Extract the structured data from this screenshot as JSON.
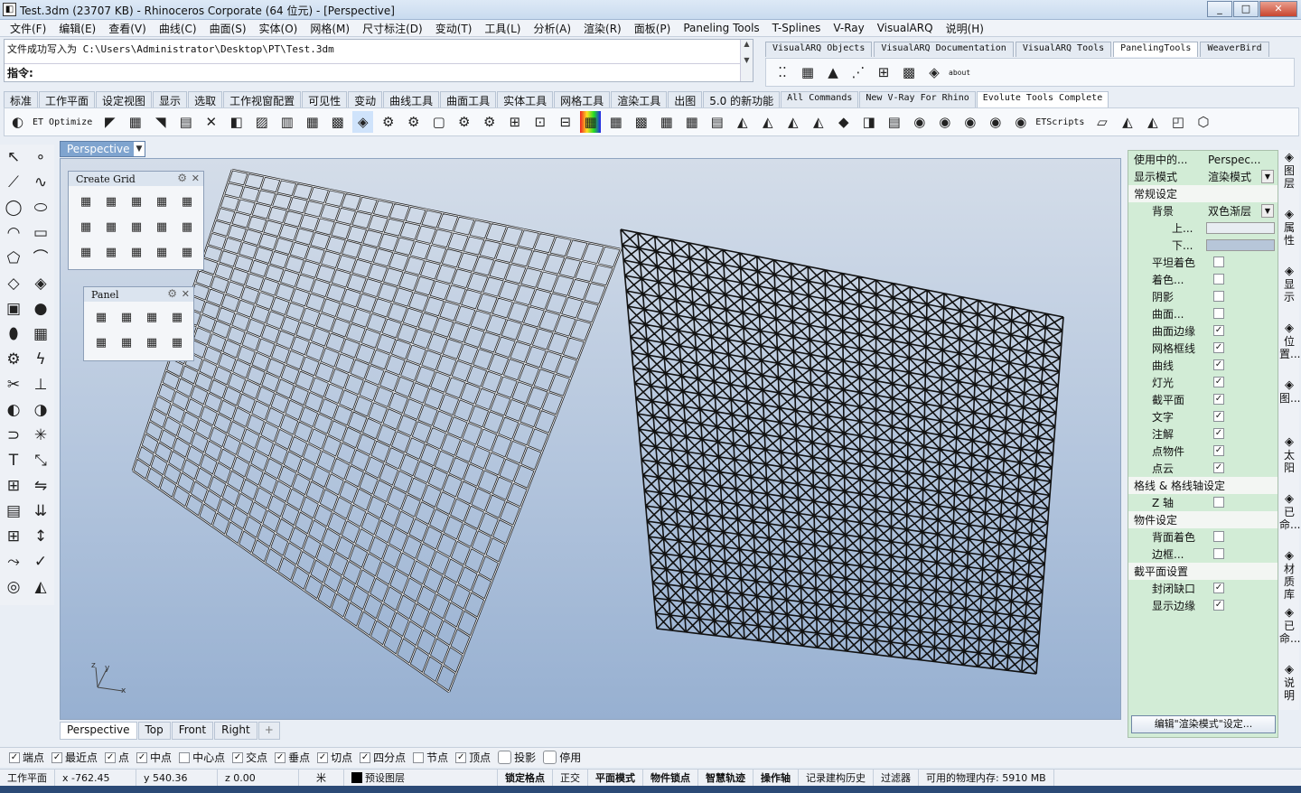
{
  "window": {
    "title": "Test.3dm (23707 KB) - Rhinoceros Corporate (64 位元) - [Perspective]",
    "buttons": [
      "_",
      "□",
      "✕"
    ]
  },
  "menu": [
    "文件(F)",
    "编辑(E)",
    "查看(V)",
    "曲线(C)",
    "曲面(S)",
    "实体(O)",
    "网格(M)",
    "尺寸标注(D)",
    "变动(T)",
    "工具(L)",
    "分析(A)",
    "渲染(R)",
    "面板(P)",
    "Paneling Tools",
    "T-Splines",
    "V-Ray",
    "VisualARQ",
    "说明(H)"
  ],
  "command": {
    "history": "文件成功写入为 C:\\Users\\Administrator\\Desktop\\PT\\Test.3dm",
    "prompt": "指令:",
    "value": ""
  },
  "plugin_tabs": [
    {
      "label": "VisualARQ Objects"
    },
    {
      "label": "VisualARQ Documentation"
    },
    {
      "label": "VisualARQ Tools"
    },
    {
      "label": "PanelingTools",
      "active": true
    },
    {
      "label": "WeaverBird"
    }
  ],
  "plugin_icons": [
    "grid-points-icon",
    "grid-dense-icon",
    "triangle-red-icon",
    "skew-grid-icon",
    "grid-tweak-icon",
    "red-square-grid-icon",
    "diamond-grid-icon"
  ],
  "about": "about",
  "main_tabs": [
    {
      "label": "标准"
    },
    {
      "label": "工作平面"
    },
    {
      "label": "设定视图"
    },
    {
      "label": "显示"
    },
    {
      "label": "选取"
    },
    {
      "label": "工作视窗配置"
    },
    {
      "label": "可见性"
    },
    {
      "label": "变动"
    },
    {
      "label": "曲线工具"
    },
    {
      "label": "曲面工具"
    },
    {
      "label": "实体工具"
    },
    {
      "label": "网格工具"
    },
    {
      "label": "渲染工具"
    },
    {
      "label": "出图"
    },
    {
      "label": "5.0 的新功能"
    },
    {
      "label": "All Commands",
      "mono": true
    },
    {
      "label": "New V-Ray For Rhino",
      "mono": true
    },
    {
      "label": "Evolute Tools Complete",
      "mono": true,
      "active": true
    }
  ],
  "toolbar": {
    "et_optimize": "ET Optimize",
    "etscripts": "ETScripts"
  },
  "sidebar_icons": [
    [
      "select-arrow-icon",
      "point-icon"
    ],
    [
      "polyline-icon",
      "control-curve-icon"
    ],
    [
      "circle-icon",
      "ellipse-icon"
    ],
    [
      "arc-icon",
      "rectangle-icon"
    ],
    [
      "polygon-icon",
      "fillet-curve-icon"
    ],
    [
      "surface-corners-icon",
      "loft-surface-icon"
    ],
    [
      "box-solid-icon",
      "sphere-solid-icon"
    ],
    [
      "cylinder-solid-icon",
      "mesh-plane-icon"
    ],
    [
      "gear-icon",
      "lightning-icon"
    ],
    [
      "trim-icon",
      "split-icon"
    ],
    [
      "boolean-union-icon",
      "boolean-split-icon"
    ],
    [
      "join-icon",
      "explode-icon"
    ],
    [
      "text-icon",
      "scale-icon"
    ],
    [
      "array-icon",
      "mirror-icon"
    ],
    [
      "extrude-icon",
      "project-icon"
    ],
    [
      "grid-array-icon",
      "dimension-icon"
    ],
    [
      "flow-icon",
      "check-icon"
    ],
    [
      "render-icon",
      "paint-icon"
    ]
  ],
  "viewport": {
    "title": "Perspective",
    "axis_x": "x",
    "axis_y": "y",
    "axis_z": "z"
  },
  "palettes": {
    "create_grid": {
      "title": "Create Grid",
      "icons": [
        "grid-uniform-icon",
        "grid-polar-icon",
        "grid-surface-icon",
        "grid-curves-icon",
        "grid-curve-dist-icon",
        "grid-extend-icon",
        "grid-array-icon",
        "grid-red-icon",
        "grid-black-icon",
        "grid-pick-icon",
        "grid-shift-icon",
        "grid-offset-icon",
        "grid-attractor-icon",
        "grid-diagonal-icon",
        "grid-morph-icon"
      ]
    },
    "panel": {
      "title": "Panel",
      "icons": [
        "panel-grid-icon",
        "panel-2d-icon",
        "panel-red-icon",
        "panel-3d-icon",
        "panel-ptn-icon",
        "panel-ptn-3d-icon",
        "panel-tri-icon",
        "panel-var-icon"
      ]
    }
  },
  "view_tabs": [
    "Perspective",
    "Top",
    "Front",
    "Right",
    "+"
  ],
  "properties": {
    "rows": [
      {
        "kind": "kv",
        "label": "使用中的...",
        "value": "Perspec..."
      },
      {
        "kind": "kv",
        "label": "显示模式",
        "value": "渲染模式",
        "dropdown": true
      },
      {
        "kind": "section",
        "label": "常规设定"
      },
      {
        "kind": "kv",
        "label": "背景",
        "value": "双色渐层",
        "dropdown": true,
        "indent": true
      },
      {
        "kind": "color",
        "label": "上...",
        "color": "#e8edf2"
      },
      {
        "kind": "color",
        "label": "下...",
        "color": "#b7c6d9"
      },
      {
        "kind": "check",
        "label": "平坦着色",
        "checked": false
      },
      {
        "kind": "check",
        "label": "着色...",
        "checked": false
      },
      {
        "kind": "check",
        "label": "阴影",
        "checked": false
      },
      {
        "kind": "check",
        "label": "曲面...",
        "checked": false
      },
      {
        "kind": "check",
        "label": "曲面边缘",
        "checked": true
      },
      {
        "kind": "check",
        "label": "网格框线",
        "checked": true
      },
      {
        "kind": "check",
        "label": "曲线",
        "checked": true
      },
      {
        "kind": "check",
        "label": "灯光",
        "checked": true
      },
      {
        "kind": "check",
        "label": "截平面",
        "checked": true
      },
      {
        "kind": "check",
        "label": "文字",
        "checked": true
      },
      {
        "kind": "check",
        "label": "注解",
        "checked": true
      },
      {
        "kind": "check",
        "label": "点物件",
        "checked": true
      },
      {
        "kind": "check",
        "label": "点云",
        "checked": true
      },
      {
        "kind": "section",
        "label": "格线 & 格线轴设定"
      },
      {
        "kind": "check",
        "label": "Z 轴",
        "checked": false
      },
      {
        "kind": "section",
        "label": "物件设定"
      },
      {
        "kind": "check",
        "label": "背面着色",
        "checked": false
      },
      {
        "kind": "check",
        "label": "边框...",
        "checked": false
      },
      {
        "kind": "section",
        "label": "截平面设置"
      },
      {
        "kind": "check",
        "label": "封闭缺口",
        "checked": true
      },
      {
        "kind": "check",
        "label": "显示边缘",
        "checked": true
      }
    ],
    "edit_button": "编辑\"渲染模式\"设定..."
  },
  "right_strip": [
    {
      "label": "图层",
      "icon": "layer-icon"
    },
    {
      "label": "属性",
      "icon": "properties-icon"
    },
    {
      "label": "显示",
      "icon": "display-icon"
    },
    {
      "label": "位置...",
      "icon": "location-icon"
    },
    {
      "label": "图...",
      "icon": "image-icon"
    },
    {
      "label": "太阳",
      "icon": "sun-icon"
    },
    {
      "label": "已命...",
      "icon": "named-views-icon"
    },
    {
      "label": "材质库",
      "icon": "material-icon"
    },
    {
      "label": "已命...",
      "icon": "named-position-icon"
    },
    {
      "label": "说明",
      "icon": "help-icon"
    }
  ],
  "osnaps": [
    {
      "label": "端点",
      "checked": true
    },
    {
      "label": "最近点",
      "checked": true
    },
    {
      "label": "点",
      "checked": true
    },
    {
      "label": "中点",
      "checked": true
    },
    {
      "label": "中心点",
      "checked": false
    },
    {
      "label": "交点",
      "checked": true
    },
    {
      "label": "垂点",
      "checked": true
    },
    {
      "label": "切点",
      "checked": true
    },
    {
      "label": "四分点",
      "checked": true
    },
    {
      "label": "节点",
      "checked": false
    },
    {
      "label": "顶点",
      "checked": true
    },
    {
      "label": "投影",
      "checked": false,
      "big": true
    },
    {
      "label": "停用",
      "checked": false,
      "big": true
    }
  ],
  "status": {
    "cplane": "工作平面",
    "x": "x -762.45",
    "y": "y 540.36",
    "z": "z 0.00",
    "unit": "米",
    "layer": "预设图层",
    "toggles": [
      "锁定格点",
      "正交",
      "平面模式",
      "物件锁点",
      "智慧轨迹",
      "操作轴",
      "记录建构历史",
      "过滤器"
    ],
    "memory": "可用的物理内存: 5910 MB"
  }
}
